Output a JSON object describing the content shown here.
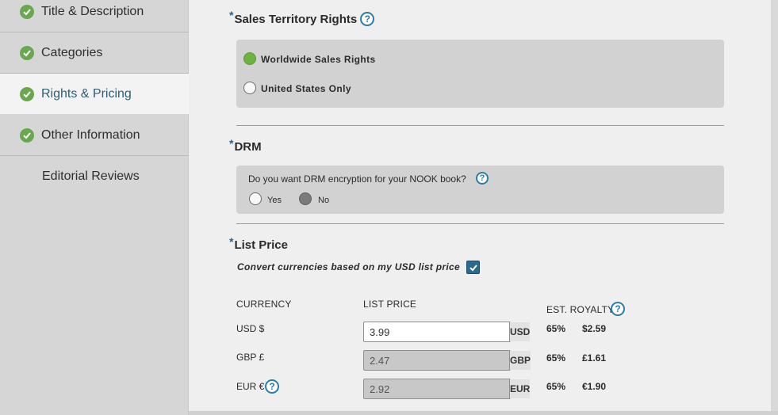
{
  "sidebar": {
    "items": [
      {
        "label": "Title & Description",
        "checked": true,
        "active": false
      },
      {
        "label": "Categories",
        "checked": true,
        "active": false
      },
      {
        "label": "Rights & Pricing",
        "checked": true,
        "active": true
      },
      {
        "label": "Other Information",
        "checked": true,
        "active": false
      },
      {
        "label": "Editorial Reviews",
        "checked": false,
        "active": false
      }
    ]
  },
  "territory": {
    "required_mark": "*",
    "title": "Sales Territory Rights",
    "help_glyph": "?",
    "options": [
      {
        "label": "Worldwide Sales Rights",
        "selected": true
      },
      {
        "label": "United States Only",
        "selected": false
      }
    ]
  },
  "drm": {
    "required_mark": "*",
    "title": "DRM",
    "question": "Do you want DRM encryption for your NOOK book?",
    "help_glyph": "?",
    "options": [
      {
        "label": "Yes",
        "selected": false
      },
      {
        "label": "No",
        "selected": true
      }
    ]
  },
  "list_price": {
    "required_mark": "*",
    "title": "List Price",
    "convert_label": "Convert currencies based on my USD list price",
    "convert_checked": true,
    "headers": {
      "currency": "CURRENCY",
      "list_price": "LIST PRICE",
      "royalty": "EST. ROYALTY"
    },
    "help_glyph": "?",
    "rows": [
      {
        "currency": "USD $",
        "price": "3.99",
        "unit": "USD",
        "percent": "65%",
        "amount": "$2.59",
        "editable": true
      },
      {
        "currency": "GBP £",
        "price": "2.47",
        "unit": "GBP",
        "percent": "65%",
        "amount": "£1.61",
        "editable": false
      },
      {
        "currency": "EUR €",
        "price": "2.92",
        "unit": "EUR",
        "percent": "65%",
        "amount": "€1.90",
        "editable": false
      }
    ]
  },
  "colors": {
    "accent": "#2c7ca8",
    "check_green": "#6aa84f",
    "active_text": "#2c5f73",
    "panel": "#d2d2d2",
    "sidebar": "#d6d6d6"
  }
}
